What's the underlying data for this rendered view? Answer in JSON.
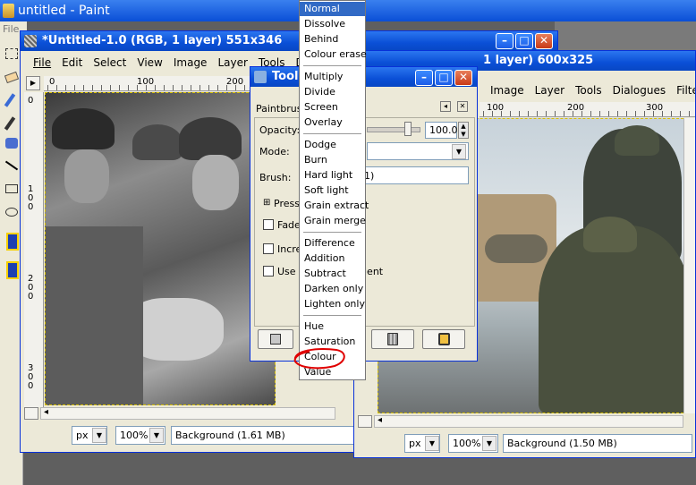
{
  "outer": {
    "title": "untitled - Paint",
    "menu_fragment": "File"
  },
  "win1": {
    "title": "*Untitled-1.0 (RGB, 1 layer) 551x346",
    "menu": [
      "File",
      "Edit",
      "Select",
      "View",
      "Image",
      "Layer",
      "Tools",
      "Dialogs"
    ],
    "ruler_labels": [
      "0",
      "100",
      "200"
    ],
    "vruler_labels": [
      "0",
      "1\n0\n0",
      "2\n0\n0",
      "3\n0\n0"
    ],
    "unit": "px",
    "zoom": "100%",
    "status": "Background (1.61 MB)"
  },
  "win2": {
    "title": "1 layer) 600x325",
    "menu": [
      "Image",
      "Layer",
      "Tools",
      "Dialogues",
      "Filters"
    ],
    "ruler_labels": [
      "100",
      "200",
      "300"
    ],
    "unit": "px",
    "zoom": "100%",
    "status": "Background (1.50 MB)"
  },
  "toolwin": {
    "title": "Tool",
    "section": "Paintbrush",
    "opacity_label": "Opacity:",
    "opacity_value": "100.0",
    "mode_label": "Mode:",
    "brush_label": "Brush:",
    "brush_value": "1)",
    "pressure_label": "Pressu",
    "fade_label": "Fade",
    "incr_label": "Incre",
    "gradient_label": "Use c",
    "gradient_suffix": "ient"
  },
  "blend_menu": {
    "items": [
      "Normal",
      "Dissolve",
      "Behind",
      "Colour erase",
      "Multiply",
      "Divide",
      "Screen",
      "Overlay",
      "Dodge",
      "Burn",
      "Hard light",
      "Soft light",
      "Grain extract",
      "Grain merge",
      "Difference",
      "Addition",
      "Subtract",
      "Darken only",
      "Lighten only",
      "Hue",
      "Saturation",
      "Colour",
      "Value"
    ],
    "selected": "Normal",
    "circled": "Colour"
  },
  "colors": {
    "xp_blue": "#0a4fd6",
    "selection": "#316ac5",
    "annotation": "#e00000"
  }
}
